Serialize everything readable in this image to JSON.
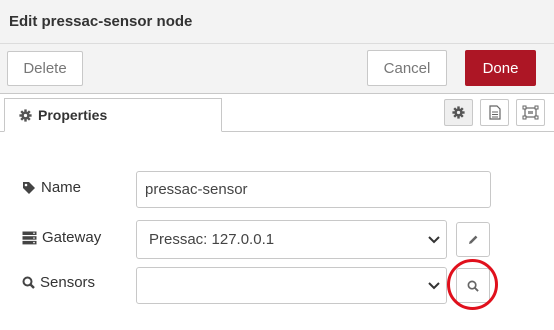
{
  "dialog": {
    "title": "Edit pressac-sensor node"
  },
  "toolbar": {
    "delete_label": "Delete",
    "cancel_label": "Cancel",
    "done_label": "Done"
  },
  "tabs": {
    "properties_label": "Properties",
    "icons": [
      "gear-icon",
      "description-icon",
      "appearance-icon"
    ]
  },
  "form": {
    "name_label": "Name",
    "name_value": "pressac-sensor",
    "gateway_label": "Gateway",
    "gateway_value": "Pressac: 127.0.0.1",
    "sensors_label": "Sensors",
    "sensors_value": ""
  },
  "colors": {
    "done_button": "#ad1625",
    "highlight_ring": "#e0101c",
    "header_bg": "#f3f3f3"
  }
}
